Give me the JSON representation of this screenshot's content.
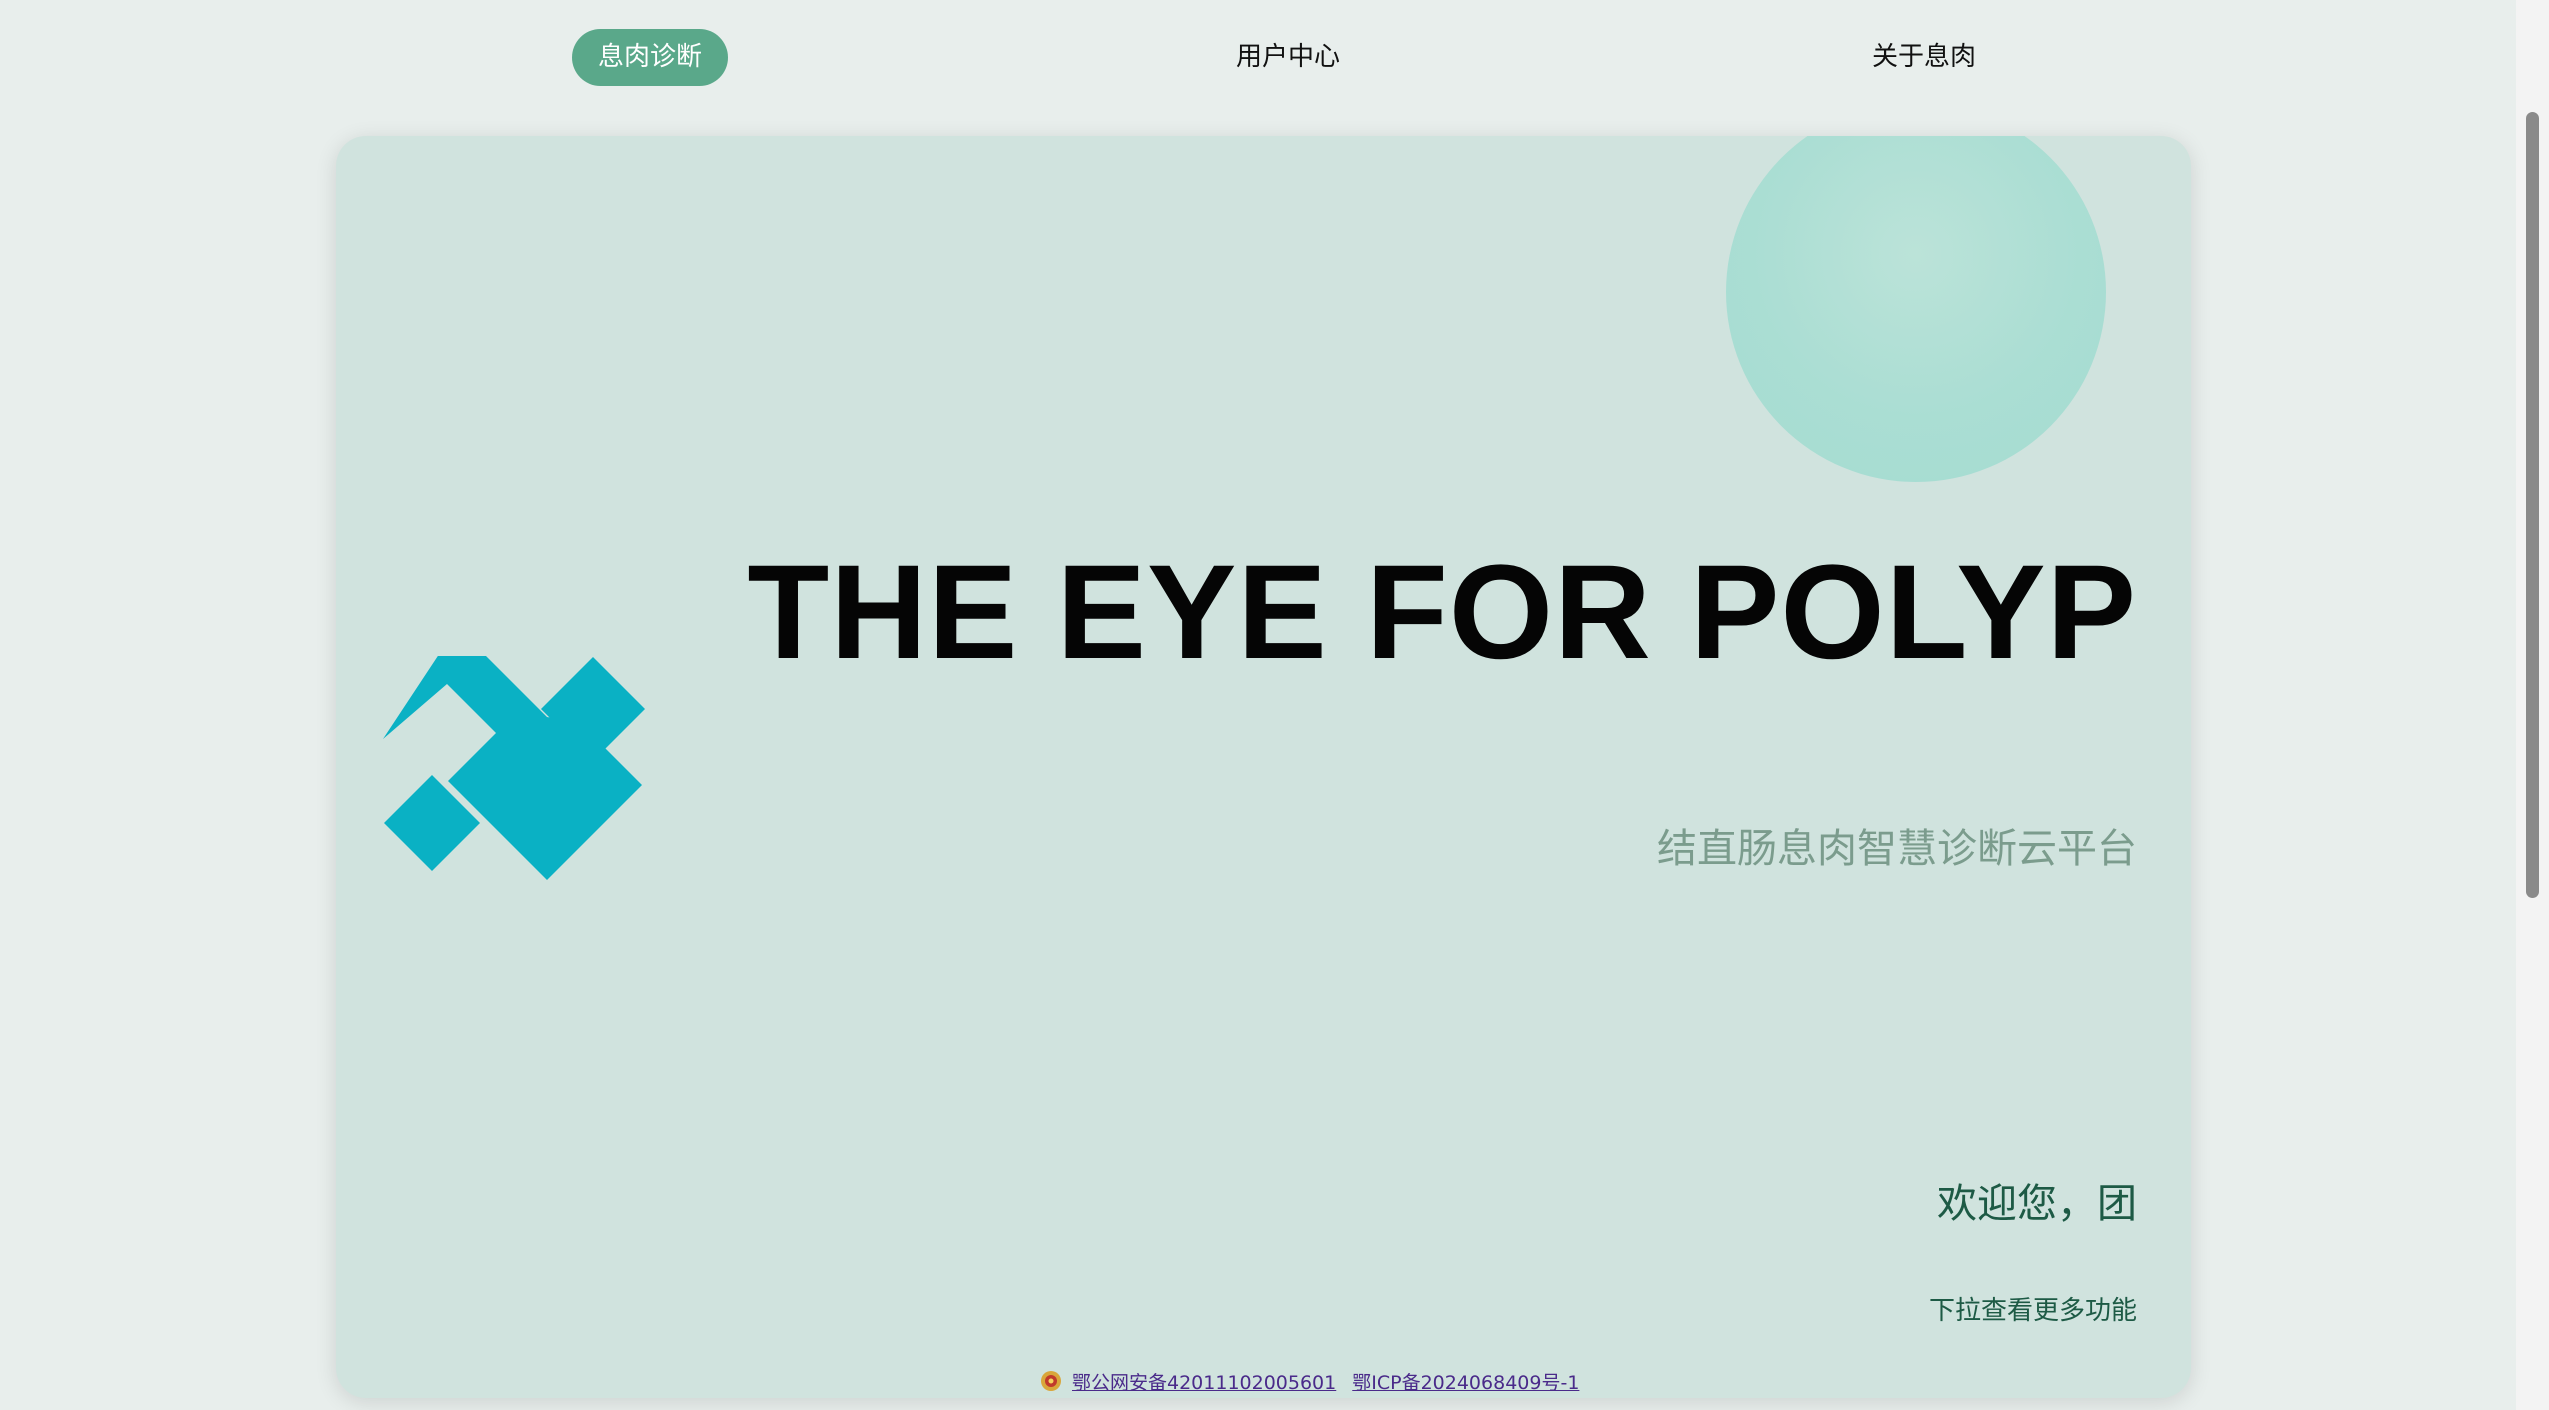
{
  "nav": {
    "items": [
      {
        "label": "息肉诊断",
        "active": true
      },
      {
        "label": "用户中心",
        "active": false
      },
      {
        "label": "关于息肉",
        "active": false
      }
    ]
  },
  "hero": {
    "title": "THE EYE FOR POLYP",
    "subtitle": "结直肠息肉智慧诊断云平台",
    "welcome": "欢迎您，团",
    "more_hint": "下拉查看更多功能"
  },
  "footer": {
    "police_record": "鄂公网安备42011102005601",
    "icp_record": "鄂ICP备2024068409号-1"
  },
  "colors": {
    "accent": "#5aa88a",
    "logo": "#0ab1c4",
    "card_bg": "#d0e3de"
  },
  "icons": {
    "logo": "diamond-n-logo-icon",
    "police_badge": "police-badge-icon"
  }
}
